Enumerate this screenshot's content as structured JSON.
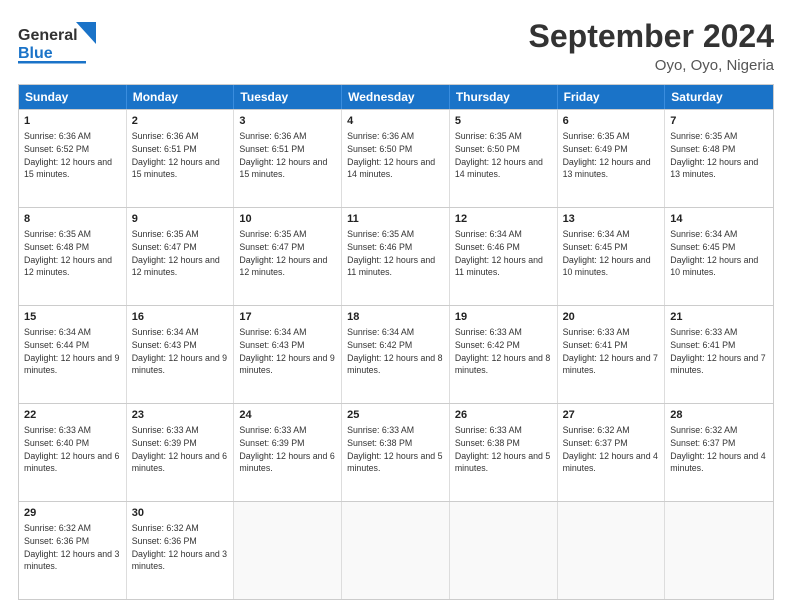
{
  "header": {
    "logo_line1": "General",
    "logo_line2": "Blue",
    "title": "September 2024",
    "subtitle": "Oyo, Oyo, Nigeria"
  },
  "days": [
    "Sunday",
    "Monday",
    "Tuesday",
    "Wednesday",
    "Thursday",
    "Friday",
    "Saturday"
  ],
  "weeks": [
    [
      {
        "day": "1",
        "sunrise": "6:36 AM",
        "sunset": "6:52 PM",
        "daylight": "12 hours and 15 minutes."
      },
      {
        "day": "2",
        "sunrise": "6:36 AM",
        "sunset": "6:51 PM",
        "daylight": "12 hours and 15 minutes."
      },
      {
        "day": "3",
        "sunrise": "6:36 AM",
        "sunset": "6:51 PM",
        "daylight": "12 hours and 15 minutes."
      },
      {
        "day": "4",
        "sunrise": "6:36 AM",
        "sunset": "6:50 PM",
        "daylight": "12 hours and 14 minutes."
      },
      {
        "day": "5",
        "sunrise": "6:35 AM",
        "sunset": "6:50 PM",
        "daylight": "12 hours and 14 minutes."
      },
      {
        "day": "6",
        "sunrise": "6:35 AM",
        "sunset": "6:49 PM",
        "daylight": "12 hours and 13 minutes."
      },
      {
        "day": "7",
        "sunrise": "6:35 AM",
        "sunset": "6:48 PM",
        "daylight": "12 hours and 13 minutes."
      }
    ],
    [
      {
        "day": "8",
        "sunrise": "6:35 AM",
        "sunset": "6:48 PM",
        "daylight": "12 hours and 12 minutes."
      },
      {
        "day": "9",
        "sunrise": "6:35 AM",
        "sunset": "6:47 PM",
        "daylight": "12 hours and 12 minutes."
      },
      {
        "day": "10",
        "sunrise": "6:35 AM",
        "sunset": "6:47 PM",
        "daylight": "12 hours and 12 minutes."
      },
      {
        "day": "11",
        "sunrise": "6:35 AM",
        "sunset": "6:46 PM",
        "daylight": "12 hours and 11 minutes."
      },
      {
        "day": "12",
        "sunrise": "6:34 AM",
        "sunset": "6:46 PM",
        "daylight": "12 hours and 11 minutes."
      },
      {
        "day": "13",
        "sunrise": "6:34 AM",
        "sunset": "6:45 PM",
        "daylight": "12 hours and 10 minutes."
      },
      {
        "day": "14",
        "sunrise": "6:34 AM",
        "sunset": "6:45 PM",
        "daylight": "12 hours and 10 minutes."
      }
    ],
    [
      {
        "day": "15",
        "sunrise": "6:34 AM",
        "sunset": "6:44 PM",
        "daylight": "12 hours and 9 minutes."
      },
      {
        "day": "16",
        "sunrise": "6:34 AM",
        "sunset": "6:43 PM",
        "daylight": "12 hours and 9 minutes."
      },
      {
        "day": "17",
        "sunrise": "6:34 AM",
        "sunset": "6:43 PM",
        "daylight": "12 hours and 9 minutes."
      },
      {
        "day": "18",
        "sunrise": "6:34 AM",
        "sunset": "6:42 PM",
        "daylight": "12 hours and 8 minutes."
      },
      {
        "day": "19",
        "sunrise": "6:33 AM",
        "sunset": "6:42 PM",
        "daylight": "12 hours and 8 minutes."
      },
      {
        "day": "20",
        "sunrise": "6:33 AM",
        "sunset": "6:41 PM",
        "daylight": "12 hours and 7 minutes."
      },
      {
        "day": "21",
        "sunrise": "6:33 AM",
        "sunset": "6:41 PM",
        "daylight": "12 hours and 7 minutes."
      }
    ],
    [
      {
        "day": "22",
        "sunrise": "6:33 AM",
        "sunset": "6:40 PM",
        "daylight": "12 hours and 6 minutes."
      },
      {
        "day": "23",
        "sunrise": "6:33 AM",
        "sunset": "6:39 PM",
        "daylight": "12 hours and 6 minutes."
      },
      {
        "day": "24",
        "sunrise": "6:33 AM",
        "sunset": "6:39 PM",
        "daylight": "12 hours and 6 minutes."
      },
      {
        "day": "25",
        "sunrise": "6:33 AM",
        "sunset": "6:38 PM",
        "daylight": "12 hours and 5 minutes."
      },
      {
        "day": "26",
        "sunrise": "6:33 AM",
        "sunset": "6:38 PM",
        "daylight": "12 hours and 5 minutes."
      },
      {
        "day": "27",
        "sunrise": "6:32 AM",
        "sunset": "6:37 PM",
        "daylight": "12 hours and 4 minutes."
      },
      {
        "day": "28",
        "sunrise": "6:32 AM",
        "sunset": "6:37 PM",
        "daylight": "12 hours and 4 minutes."
      }
    ],
    [
      {
        "day": "29",
        "sunrise": "6:32 AM",
        "sunset": "6:36 PM",
        "daylight": "12 hours and 3 minutes."
      },
      {
        "day": "30",
        "sunrise": "6:32 AM",
        "sunset": "6:36 PM",
        "daylight": "12 hours and 3 minutes."
      },
      null,
      null,
      null,
      null,
      null
    ]
  ],
  "labels": {
    "sunrise": "Sunrise:",
    "sunset": "Sunset:",
    "daylight": "Daylight:"
  }
}
